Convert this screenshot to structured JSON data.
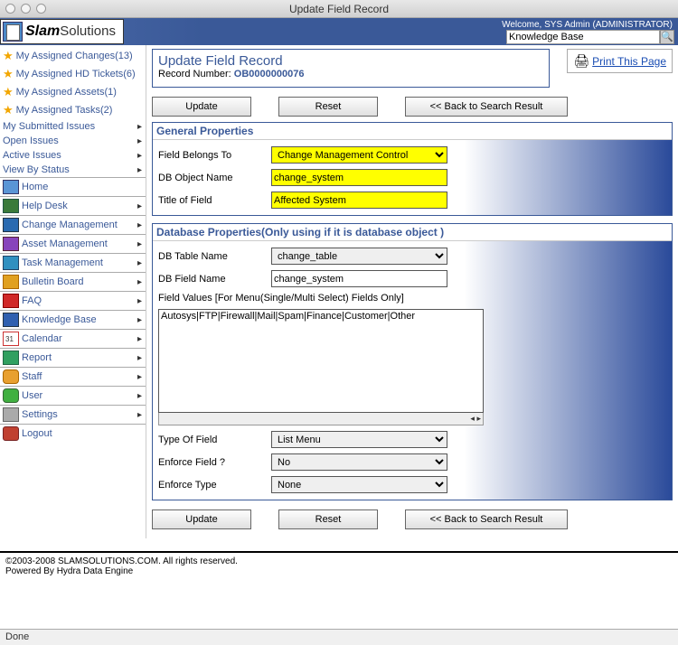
{
  "window": {
    "title": "Update Field Record"
  },
  "header": {
    "logo1": "Slam",
    "logo2": "Solutions",
    "welcome": "Welcome, SYS Admin (ADMINISTRATOR)",
    "search_value": "Knowledge Base"
  },
  "sidebar": {
    "ass_changes": "My Assigned Changes(13)",
    "ass_hd": "My Assigned HD Tickets(6)",
    "ass_assets": "My Assigned Assets(1)",
    "ass_tasks": "My Assigned Tasks(2)",
    "sub_issues": "My Submitted Issues",
    "open_issues": "Open Issues",
    "active_issues": "Active Issues",
    "view_status": "View By Status",
    "home": "Home",
    "help_desk": "Help Desk",
    "change_mgmt": "Change Management",
    "asset_mgmt": "Asset Management",
    "task_mgmt": "Task Management",
    "bulletin": "Bulletin Board",
    "faq": "FAQ",
    "kb": "Knowledge Base",
    "calendar": "Calendar",
    "report": "Report",
    "staff": "Staff",
    "user": "User",
    "settings": "Settings",
    "logout": "Logout"
  },
  "page": {
    "title": "Update Field Record",
    "record_label": "Record Number: ",
    "record_num": "OB0000000076",
    "print": "Print This Page"
  },
  "buttons": {
    "update": "Update",
    "reset": "Reset",
    "back": "<< Back to Search Result"
  },
  "general": {
    "header": "General Properties",
    "belongs_label": "Field Belongs To",
    "belongs_value": "Change Management Control",
    "obj_label": "DB Object Name",
    "obj_value": "change_system",
    "title_label": "Title of Field",
    "title_value": "Affected System"
  },
  "db": {
    "header": "Database Properties(Only using if it is database object )",
    "table_label": "DB Table Name",
    "table_value": "change_table",
    "field_label": "DB Field Name",
    "field_value": "change_system",
    "values_label": "Field Values [For Menu(Single/Multi Select) Fields Only]",
    "values_text": "Autosys|FTP|Firewall|Mail|Spam|Finance|Customer|Other",
    "type_label": "Type Of Field",
    "type_value": "List Menu",
    "enforce_label": "Enforce Field ?",
    "enforce_value": "No",
    "etype_label": "Enforce Type",
    "etype_value": "None"
  },
  "footer": {
    "copy": "©2003-2008 SLAMSOLUTIONS.COM. All rights reserved.",
    "powered": "Powered By Hydra Data Engine"
  },
  "status": {
    "text": "Done"
  }
}
